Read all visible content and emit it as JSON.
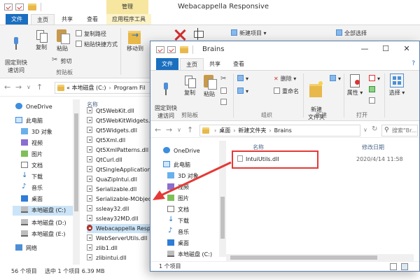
{
  "back": {
    "title": "Webacappella Responsive",
    "context_tab_header": "管理",
    "tabs": [
      "文件",
      "主页",
      "共享",
      "查看"
    ],
    "context_subtab": "应用程序工具",
    "ribbon": {
      "pin_label": "固定到快\n速访问",
      "copy_label": "复制",
      "paste_label": "粘贴",
      "copy_path": "复制路径",
      "paste_shortcut": "粘贴快捷方式",
      "cut": "剪切",
      "clipboard_group": "剪贴板",
      "move_to": "移动到",
      "new_item": "新建项目",
      "select_all": "全部选择"
    },
    "address_prefix": "«",
    "address_path": [
      "本地磁盘 (C:)",
      "Program Fil"
    ],
    "nav": [
      "OneDrive",
      "此电脑",
      "3D 对象",
      "视频",
      "图片",
      "文档",
      "下载",
      "音乐",
      "桌面",
      "本地磁盘 (C:)",
      "本地磁盘 (D:)",
      "本地磁盘 (E:)",
      "网络"
    ],
    "name_header": "名称",
    "files": [
      "Qt5WebKit.dll",
      "Qt5WebKitWidgets.",
      "Qt5Widgets.dll",
      "Qt5Xml.dll",
      "Qt5XmlPatterns.dll",
      "QtCurl.dll",
      "QtSingleApplication",
      "QuaZipIntui.dll",
      "Serializable.dll",
      "Serializable-MObjec",
      "ssleay32.dll",
      "ssleay32MD.dll",
      "Webacappella Respo",
      "WebServerUtils.dll",
      "zlib1.dll",
      "zlibintui.dll"
    ],
    "status_count": "56 个项目",
    "status_selected": "选中 1 个项目  6.39 MB"
  },
  "front": {
    "title": "Brains",
    "tabs": [
      "文件",
      "主页",
      "共享",
      "查看"
    ],
    "ribbon": {
      "pin_label": "固定到快\n速访问",
      "copy_label": "复制",
      "paste_label": "粘贴",
      "clipboard_group": "剪贴板",
      "organize_group": "组织",
      "delete": "删除",
      "rename": "重命名",
      "new_folder": "新建\n文件夹",
      "new_group": "新建",
      "properties": "属性",
      "open_group": "打开",
      "select": "选择"
    },
    "breadcrumbs": [
      "桌面",
      "新建文件夹",
      "Brains"
    ],
    "search_placeholder": "搜索\"Br...",
    "nav": [
      "OneDrive",
      "此电脑",
      "3D 对象",
      "视频",
      "图片",
      "文档",
      "下载",
      "音乐",
      "桌面",
      "本地磁盘 (C:)"
    ],
    "name_header": "名称",
    "date_header": "修改日期",
    "file": {
      "name": "IntuiUtils.dll",
      "date": "2020/4/14 11:58"
    },
    "status": "1 个项目"
  },
  "colors": {
    "accent": "#1a6fbf",
    "highlight": "#e53935",
    "context_tab": "#f6e6a0"
  }
}
